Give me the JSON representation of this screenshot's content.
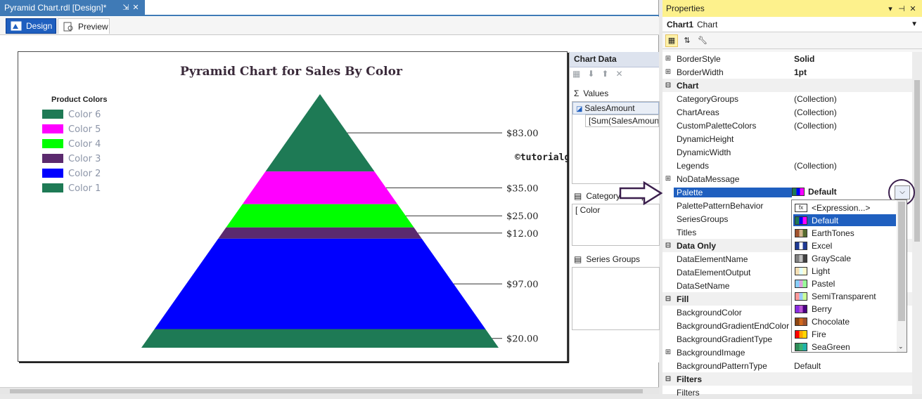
{
  "document": {
    "tab_title": "Pyramid Chart.rdl [Design]*",
    "tab_pin": "⇲",
    "tab_close": "✕",
    "view_tabs": [
      {
        "label": "Design"
      },
      {
        "label": "Preview"
      }
    ]
  },
  "chart": {
    "title": "Pyramid Chart for Sales By Color",
    "legend_title": "Product Colors",
    "watermark": "©tutorialgateway.org",
    "legend": [
      {
        "label": "Color 6",
        "color": "#1e7a55"
      },
      {
        "label": "Color 5",
        "color": "#ff00ff"
      },
      {
        "label": "Color 4",
        "color": "#00ff00"
      },
      {
        "label": "Color 3",
        "color": "#5b2a6e"
      },
      {
        "label": "Color 2",
        "color": "#0000ff"
      },
      {
        "label": "Color 1",
        "color": "#1e7a55"
      }
    ],
    "slices": [
      {
        "label": "$83.00",
        "value": 83,
        "color": "#1e7a55"
      },
      {
        "label": "$35.00",
        "value": 35,
        "color": "#ff00ff"
      },
      {
        "label": "$25.00",
        "value": 25,
        "color": "#00ff00"
      },
      {
        "label": "$12.00",
        "value": 12,
        "color": "#5b2a6e"
      },
      {
        "label": "$97.00",
        "value": 97,
        "color": "#0000ff"
      },
      {
        "label": "$20.00",
        "value": 20,
        "color": "#1e7a55"
      }
    ]
  },
  "chart_data_pane": {
    "header": "Chart Data",
    "values_label": "Values",
    "values_items": [
      "SalesAmount",
      "[Sum(SalesAmount"
    ],
    "category_label": "Category Groups",
    "category_items": [
      "Color"
    ],
    "series_label": "Series Groups"
  },
  "properties": {
    "title": "Properties",
    "title_controls": [
      "▾",
      "⊣",
      "✕"
    ],
    "object_name": "Chart1",
    "object_type": "Chart",
    "rows": [
      {
        "type": "prop",
        "exp": "⊞",
        "name": "BorderStyle",
        "value": "Solid",
        "bold": true
      },
      {
        "type": "prop",
        "exp": "⊞",
        "name": "BorderWidth",
        "value": "1pt",
        "bold": true
      },
      {
        "type": "cat",
        "exp": "⊟",
        "name": "Chart"
      },
      {
        "type": "prop",
        "exp": "",
        "name": "CategoryGroups",
        "value": "(Collection)"
      },
      {
        "type": "prop",
        "exp": "",
        "name": "ChartAreas",
        "value": "(Collection)"
      },
      {
        "type": "prop",
        "exp": "",
        "name": "CustomPaletteColors",
        "value": "(Collection)"
      },
      {
        "type": "prop",
        "exp": "",
        "name": "DynamicHeight",
        "value": ""
      },
      {
        "type": "prop",
        "exp": "",
        "name": "DynamicWidth",
        "value": ""
      },
      {
        "type": "prop",
        "exp": "",
        "name": "Legends",
        "value": "(Collection)"
      },
      {
        "type": "prop",
        "exp": "⊞",
        "name": "NoDataMessage",
        "value": ""
      },
      {
        "type": "prop",
        "exp": "",
        "name": "Palette",
        "value": "",
        "selected": true
      },
      {
        "type": "prop",
        "exp": "",
        "name": "PalettePatternBehavior",
        "value": ""
      },
      {
        "type": "prop",
        "exp": "",
        "name": "SeriesGroups",
        "value": ""
      },
      {
        "type": "prop",
        "exp": "",
        "name": "Titles",
        "value": ""
      },
      {
        "type": "cat",
        "exp": "⊟",
        "name": "Data Only"
      },
      {
        "type": "prop",
        "exp": "",
        "name": "DataElementName",
        "value": ""
      },
      {
        "type": "prop",
        "exp": "",
        "name": "DataElementOutput",
        "value": ""
      },
      {
        "type": "prop",
        "exp": "",
        "name": "DataSetName",
        "value": ""
      },
      {
        "type": "cat",
        "exp": "⊟",
        "name": "Fill"
      },
      {
        "type": "prop",
        "exp": "",
        "name": "BackgroundColor",
        "value": ""
      },
      {
        "type": "prop",
        "exp": "",
        "name": "BackgroundGradientEndColor",
        "value": ""
      },
      {
        "type": "prop",
        "exp": "",
        "name": "BackgroundGradientType",
        "value": ""
      },
      {
        "type": "prop",
        "exp": "⊞",
        "name": "BackgroundImage",
        "value": ""
      },
      {
        "type": "prop",
        "exp": "",
        "name": "BackgroundPatternType",
        "value": "Default"
      },
      {
        "type": "cat",
        "exp": "⊟",
        "name": "Filters"
      },
      {
        "type": "prop",
        "exp": "",
        "name": "Filters",
        "value": ""
      }
    ],
    "palette_value": "Default",
    "palette_options": [
      {
        "label": "<Expression...>",
        "icon": "fx-icon"
      },
      {
        "label": "Default",
        "selected": true,
        "colors": [
          "#1e7a55",
          "#0000ff",
          "#ff00ff"
        ]
      },
      {
        "label": "EarthTones",
        "colors": [
          "#a0522d",
          "#d2b48c",
          "#556b2f"
        ]
      },
      {
        "label": "Excel",
        "colors": [
          "#1f3a93",
          "#ffffff",
          "#1f3a93"
        ]
      },
      {
        "label": "GrayScale",
        "colors": [
          "#808080",
          "#c0c0c0",
          "#404040"
        ]
      },
      {
        "label": "Light",
        "colors": [
          "#f5deb3",
          "#e0ffff",
          "#fffacd"
        ]
      },
      {
        "label": "Pastel",
        "colors": [
          "#87cefa",
          "#dda0dd",
          "#98fb98"
        ]
      },
      {
        "label": "SemiTransparent",
        "colors": [
          "#ff9999",
          "#99ccff",
          "#ccff99"
        ]
      },
      {
        "label": "Berry",
        "colors": [
          "#8a2be2",
          "#ba55d3",
          "#4b0082"
        ]
      },
      {
        "label": "Chocolate",
        "colors": [
          "#8b4513",
          "#d2691e",
          "#a0522d"
        ]
      },
      {
        "label": "Fire",
        "colors": [
          "#ff0000",
          "#ffa500",
          "#ffd700"
        ]
      },
      {
        "label": "SeaGreen",
        "colors": [
          "#2e8b57",
          "#3cb371",
          "#20b2aa"
        ]
      }
    ]
  }
}
